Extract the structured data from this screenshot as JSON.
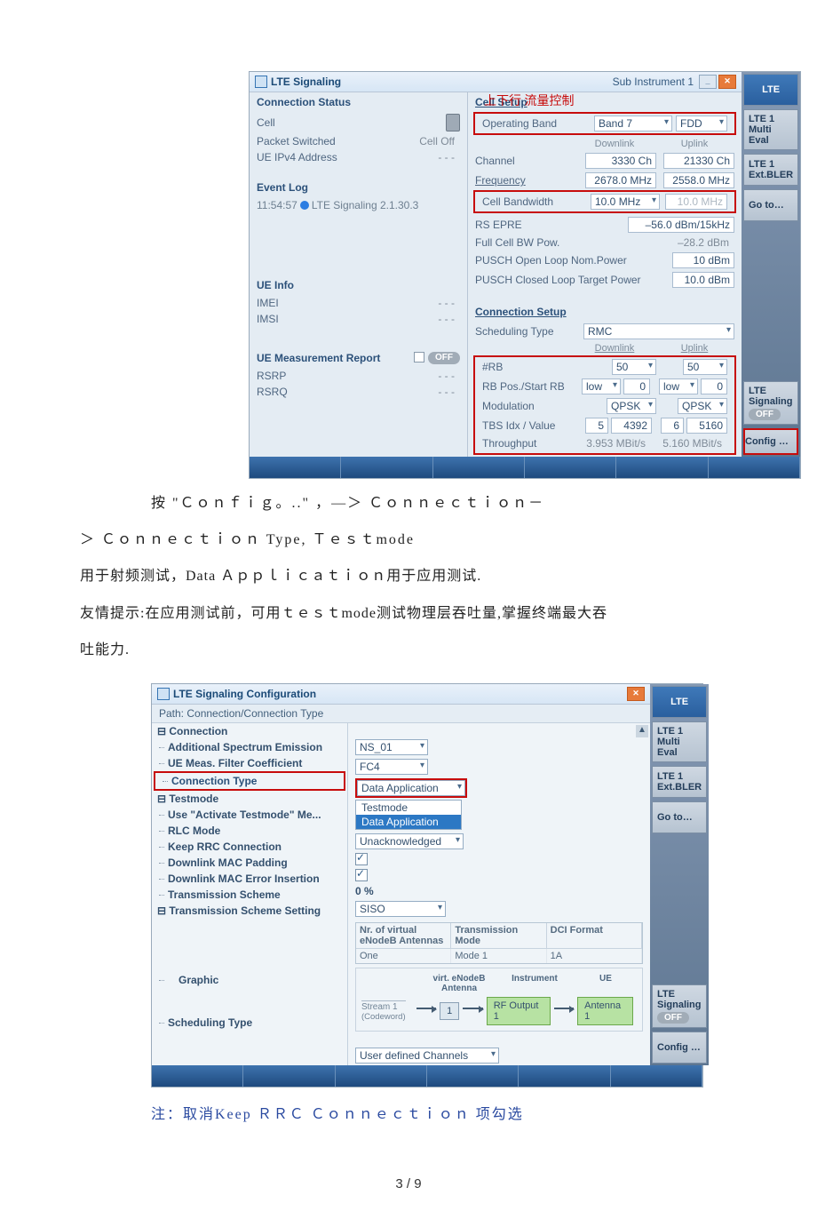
{
  "page": {
    "number": "3 / 9"
  },
  "s1": {
    "title": "LTE Signaling",
    "sub_instrument": "Sub Instrument 1",
    "conn_status_h": "Connection Status",
    "cell_lbl": "Cell",
    "ps_lbl": "Packet Switched",
    "ps_val": "Cell Off",
    "ip4_lbl": "UE IPv4 Address",
    "ip4_val": "- - -",
    "eventlog_h": "Event Log",
    "log_time": "11:54:57",
    "log_text": "LTE Signaling 2.1.30.3",
    "ueinfo_h": "UE Info",
    "imei_lbl": "IMEI",
    "imei_val": "- - -",
    "imsi_lbl": "IMSI",
    "imsi_val": "- - -",
    "uemr_h": "UE Measurement Report",
    "off_pill": "OFF",
    "rsrp_lbl": "RSRP",
    "rsrp_val": "- - -",
    "rsrq_lbl": "RSRQ",
    "rsrq_val": "- - -",
    "cellsetup_h": "Cell Setup",
    "opband_lbl": "Operating Band",
    "opband_val": "Band 7",
    "duplex_val": "FDD",
    "dl_lbl": "Downlink",
    "ul_lbl": "Uplink",
    "channel_lbl": "Channel",
    "channel_dl": "3330 Ch",
    "channel_ul": "21330 Ch",
    "freq_lbl": "Frequency",
    "freq_dl": "2678.0 MHz",
    "freq_ul": "2558.0 MHz",
    "bw_lbl": "Cell Bandwidth",
    "bw_dl": "10.0 MHz",
    "bw_ul": "10.0 MHz",
    "rsepre_lbl": "RS EPRE",
    "rsepre_val": "–56.0 dBm/15kHz",
    "fullcell_lbl": "Full Cell BW Pow.",
    "fullcell_val": "–28.2 dBm",
    "pusch_ol_lbl": "PUSCH Open Loop Nom.Power",
    "pusch_ol_val": "10 dBm",
    "pusch_cl_lbl": "PUSCH Closed Loop Target Power",
    "pusch_cl_val": "10.0 dBm",
    "connsetup_h": "Connection Setup",
    "sched_lbl": "Scheduling Type",
    "sched_val": "RMC",
    "anno_flow": "上下行 流量控制",
    "rb_lbl": "#RB",
    "rb_dl": "50",
    "rb_ul": "50",
    "rbpos_lbl": "RB Pos./Start RB",
    "rbpos_dl": "low",
    "rbpos_dl_n": "0",
    "rbpos_ul": "low",
    "rbpos_ul_n": "0",
    "mod_lbl": "Modulation",
    "mod_dl": "QPSK",
    "mod_ul": "QPSK",
    "tbs_lbl": "TBS Idx / Value",
    "tbs_dl_i": "5",
    "tbs_dl_v": "4392",
    "tbs_ul_i": "6",
    "tbs_ul_v": "5160",
    "tp_lbl": "Throughput",
    "tp_dl": "3.953 MBit/s",
    "tp_ul": "5.160 MBit/s",
    "sk_header": "LTE",
    "sk_1a": "LTE 1",
    "sk_1b": "Multi Eval",
    "sk_2a": "LTE 1",
    "sk_2b": "Ext.BLER",
    "sk_3": "Go to…",
    "sk_sig_a": "LTE",
    "sk_sig_b": "Signaling",
    "sk_config": "Config …"
  },
  "para": {
    "l1": "按 \"Ｃｏｎｆｉｇ。..\" ，—＞ Ｃｏｎｎｅｃｔｉｏｎ－",
    "l2": "＞ Ｃｏｎｎｅｃｔｉｏｎ Type, Ｔｅｓｔmode",
    "l3": "用于射频测试，Data Ａｐｐｌｉｃａｔｉｏｎ用于应用测试.",
    "l4": "友情提示:在应用测试前，可用ｔｅｓｔmode测试物理层吞吐量,掌握终端最大吞",
    "l5": "吐能力."
  },
  "s2": {
    "title": "LTE Signaling Configuration",
    "path": "Path:  Connection/Connection Type",
    "tree": {
      "root": "Connection",
      "ase": "Additional Spectrum Emission",
      "uemf": "UE Meas. Filter Coefficient",
      "ct": "Connection Type",
      "tm": "Testmode",
      "uatm": "Use \"Activate Testmode\" Me...",
      "rlc": "RLC Mode",
      "krrc": "Keep RRC Connection",
      "dmp": "Downlink MAC Padding",
      "dmei": "Downlink MAC Error Insertion",
      "ts": "Transmission Scheme",
      "tss": "Transmission Scheme Setting",
      "graphic": "Graphic",
      "st": "Scheduling Type"
    },
    "vals": {
      "ase": "NS_01",
      "uemf": "FC4",
      "ct": "Data Application",
      "dd_tm": "Testmode",
      "dd_da": "Data Application",
      "rlc": "Unacknowledged",
      "dmei": "0 %",
      "ts": "SISO",
      "st": "User defined Channels"
    },
    "tbl": {
      "h1": "Nr. of virtual eNodeB Antennas",
      "h2": "Transmission Mode",
      "h3": "DCI Format",
      "r1": "One",
      "r2": "Mode 1",
      "r3": "1A"
    },
    "graphic": {
      "vant": "virt. eNodeB Antenna",
      "inst": "Instrument",
      "ue": "UE",
      "stream": "Stream 1",
      "cw": "(Codeword)",
      "one": "1",
      "rfout": "RF Output 1",
      "ant1": "Antenna 1"
    },
    "sk_header": "LTE",
    "sk_1a": "LTE 1",
    "sk_1b": "Multi Eval",
    "sk_2a": "LTE 1",
    "sk_2b": "Ext.BLER",
    "sk_3": "Go to…",
    "sk_sig_a": "LTE",
    "sk_sig_b": "Signaling",
    "off_pill": "OFF",
    "sk_config": "Config …"
  },
  "note": "注：取消Keep ＲＲＣ Ｃｏｎｎｅｃｔｉｏｎ 项勾选"
}
